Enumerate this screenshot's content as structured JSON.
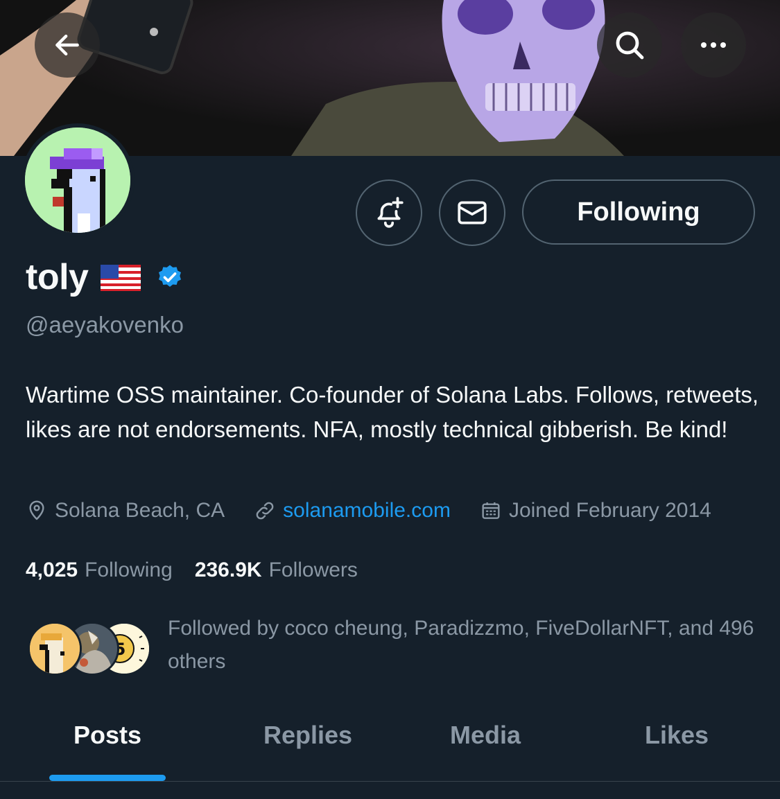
{
  "header": {
    "back_icon": "arrow-left-icon",
    "search_icon": "search-icon",
    "more_icon": "more-horizontal-icon"
  },
  "profile": {
    "name": "toly",
    "flag_icon": "us-flag-icon",
    "verified_icon": "verified-badge-icon",
    "handle": "@aeyakovenko",
    "bio": "Wartime OSS maintainer. Co-founder of Solana Labs. Follows, retweets, likes are not endorsements. NFA, mostly technical gibberish. Be kind!",
    "location": "Solana Beach, CA",
    "website": "solanamobile.com",
    "joined": "Joined February 2014"
  },
  "actions": {
    "notify_icon": "bell-plus-icon",
    "message_icon": "envelope-icon",
    "follow_label": "Following"
  },
  "stats": {
    "following_count": "4,025",
    "following_label": "Following",
    "followers_count": "236.9K",
    "followers_label": "Followers"
  },
  "followed_by": {
    "text": "Followed by coco cheung, Paradizzmo, FiveDollarNFT, and 496 others"
  },
  "tabs": [
    {
      "label": "Posts",
      "active": true
    },
    {
      "label": "Replies",
      "active": false
    },
    {
      "label": "Media",
      "active": false
    },
    {
      "label": "Likes",
      "active": false
    }
  ],
  "colors": {
    "background": "#15202b",
    "accent": "#1d9bf0",
    "secondary_text": "#8b98a5",
    "border": "#536471"
  }
}
